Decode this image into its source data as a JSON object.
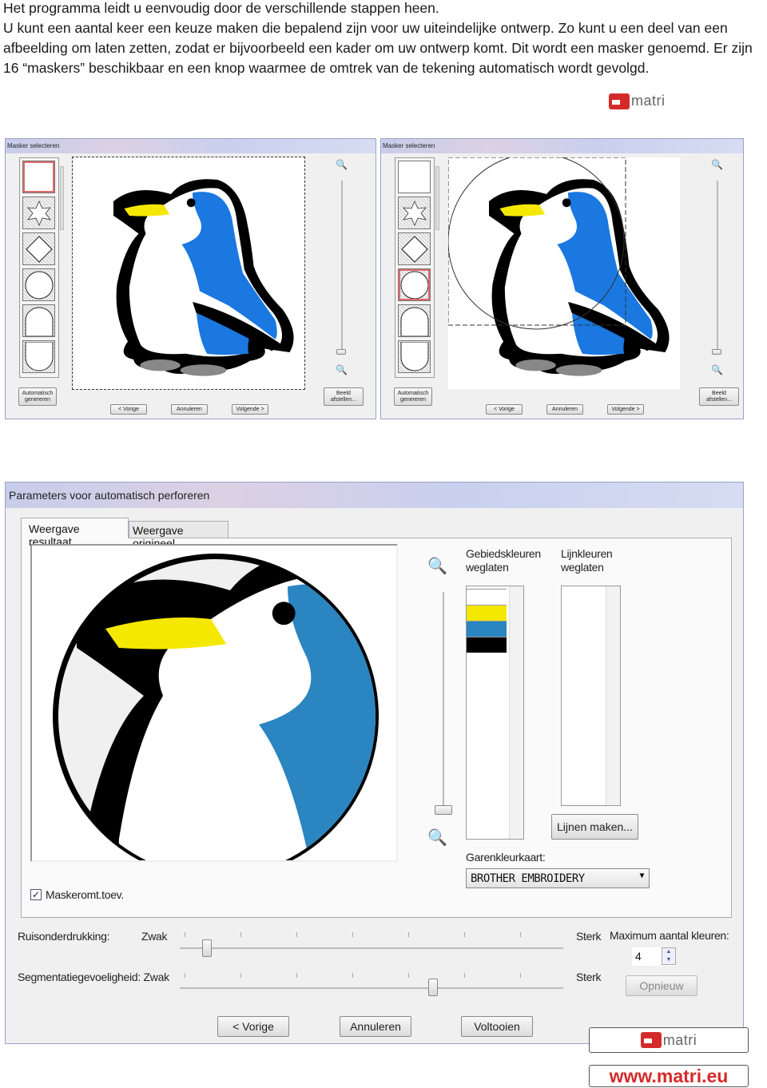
{
  "intro": {
    "lines": [
      "Het programma leidt u eenvoudig door de verschillende stappen heen.",
      "U kunt een aantal keer een keuze maken die bepalend zijn voor uw uiteindelijke ontwerp. Zo kunt u een deel van een afbeelding om laten zetten, zodat er bijvoorbeeld een kader om uw ontwerp komt. Dit wordt een masker genoemd. Er zijn 16 “maskers”  beschikbaar en een knop waarmee de omtrek van de tekening automatisch wordt gevolgd."
    ]
  },
  "logo": {
    "text": "matri",
    "url_text": "www.matri.eu",
    "brand_color": "#d42a2a"
  },
  "mask_dialogs": [
    {
      "title": "Masker selecteren",
      "auto_button": "Automatisch genereren",
      "image_button": "Beeld afstellen...",
      "prev": "< Vorige",
      "cancel": "Annuleren",
      "next": "Volgende >",
      "selected_mask": "rectangle"
    },
    {
      "title": "Masker selecteren",
      "auto_button": "Automatisch genereren",
      "image_button": "Beeld afstellen...",
      "prev": "< Vorige",
      "cancel": "Annuleren",
      "next": "Volgende >",
      "selected_mask": "circle"
    }
  ],
  "perforate_dialog": {
    "title": "Parameters voor automatisch perforeren",
    "tabs": [
      {
        "label": "Weergave resultaat",
        "active": true
      },
      {
        "label": "Weergave origineel",
        "active": false
      }
    ],
    "area_colors_label": "Gebiedskleuren weglaten",
    "line_colors_label": "Lijnkleuren weglaten",
    "area_colors": [
      "#ffffff",
      "#f5e800",
      "#2a85c0",
      "#000000"
    ],
    "make_lines_button": "Lijnen maken...",
    "thread_chart_label": "Garenkleurkaart:",
    "thread_chart_value": "BROTHER EMBROIDERY",
    "mask_outline_checkbox": {
      "label": "Maskeromt.toev.",
      "checked": true
    },
    "noise_label": "Ruisonderdrukking:",
    "segmentation_label": "Segmentatiegevoeligheid:",
    "weak": "Zwak",
    "strong": "Sterk",
    "noise_value_percent": 7,
    "segmentation_value_percent": 66,
    "max_colors_label": "Maximum aantal kleuren:",
    "max_colors_value": "4",
    "redo_button": "Opnieuw",
    "prev": "< Vorige",
    "cancel": "Annuleren",
    "finish": "Voltooien"
  }
}
